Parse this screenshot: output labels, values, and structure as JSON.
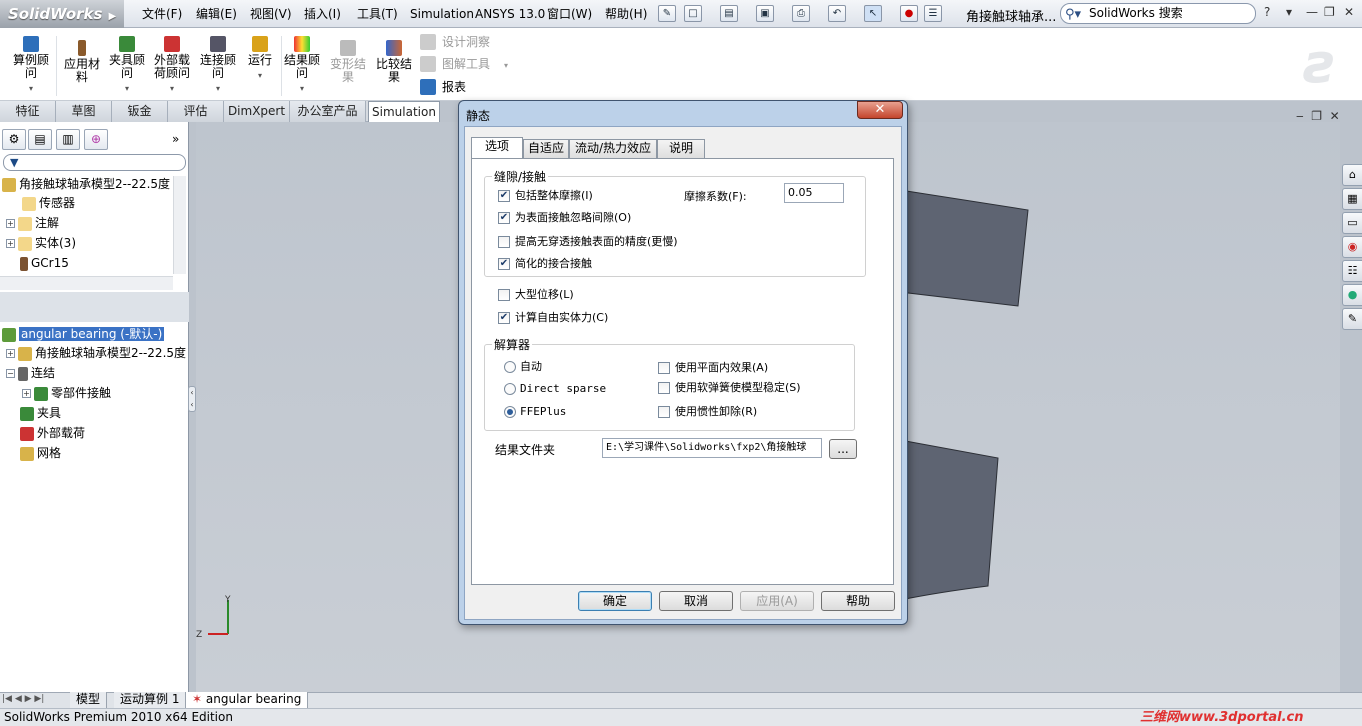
{
  "app": {
    "logo": "SolidWorks",
    "doc_title": "角接触球轴承...",
    "status": "SolidWorks Premium 2010 x64 Edition",
    "watermark": "三维网www.3dportal.cn"
  },
  "menu": [
    "文件(F)",
    "编辑(E)",
    "视图(V)",
    "插入(I)",
    "工具(T)",
    "Simulation",
    "ANSYS 13.0",
    "窗口(W)",
    "帮助(H)"
  ],
  "search": {
    "placeholder": "SolidWorks 搜索"
  },
  "ribbon": {
    "buttons": [
      {
        "label": "算例顾问",
        "icon": "study-advisor-icon"
      },
      {
        "label": "应用材料",
        "icon": "apply-material-icon"
      },
      {
        "label": "夹具顾问",
        "icon": "fixtures-advisor-icon"
      },
      {
        "label": "外部载荷顾问",
        "icon": "external-loads-icon"
      },
      {
        "label": "连接顾问",
        "icon": "connections-advisor-icon"
      },
      {
        "label": "运行",
        "icon": "run-icon"
      },
      {
        "label": "结果顾问",
        "icon": "results-advisor-icon"
      },
      {
        "label": "变形结果",
        "icon": "deformed-result-icon"
      },
      {
        "label": "比较结果",
        "icon": "compare-results-icon"
      }
    ],
    "small": [
      "设计洞察",
      "图解工具",
      "报表"
    ]
  },
  "tabs": [
    "特征",
    "草图",
    "钣金",
    "评估",
    "DimXpert",
    "办公室产品",
    "Simulation"
  ],
  "feature_tree": {
    "filter": "",
    "root": "角接触球轴承模型2--22.5度",
    "items": [
      "传感器",
      "注解",
      "实体(3)",
      "GCr15"
    ]
  },
  "study_tree": {
    "root": "angular bearing (-默认-)",
    "items": [
      "角接触球轴承模型2--22.5度",
      "连结",
      "零部件接触",
      "夹具",
      "外部载荷",
      "网格"
    ]
  },
  "bottom_tabs": [
    "模型",
    "运动算例 1",
    "angular bearing"
  ],
  "dialog": {
    "title": "静态",
    "tabs": [
      "选项",
      "自适应",
      "流动/热力效应",
      "说明"
    ],
    "gap_group": "缝隙/接触",
    "opt_friction": "包括整体摩擦(I)",
    "friction_label": "摩擦系数(F):",
    "friction_value": "0.05",
    "opt_ignore_clearance": "为表面接触忽略间隙(O)",
    "opt_accuracy": "提高无穿透接触表面的精度(更慢)",
    "opt_simplified": "简化的接合接触",
    "opt_large_disp": "大型位移(L)",
    "opt_free_body": "计算自由实体力(C)",
    "solver_group": "解算器",
    "solver_auto": "自动",
    "solver_direct": "Direct sparse",
    "solver_ffe": "FFEPlus",
    "opt_inplane": "使用平面内效果(A)",
    "opt_soft_spring": "使用软弹簧使模型稳定(S)",
    "opt_inertial": "使用惯性卸除(R)",
    "result_folder_label": "结果文件夹",
    "result_folder_value": "E:\\学习课件\\Solidworks\\fxp2\\角接触球",
    "browse": "...",
    "ok": "确定",
    "cancel": "取消",
    "apply": "应用(A)",
    "help": "帮助"
  }
}
